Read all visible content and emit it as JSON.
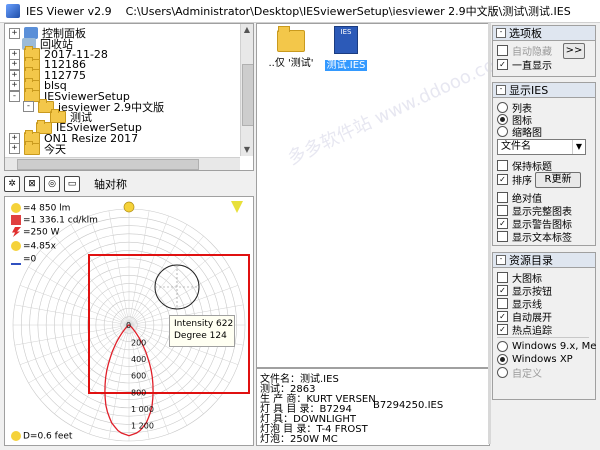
{
  "titlebar": {
    "app": "IES Viewer v2.9",
    "path": "C:\\Users\\Administrator\\Desktop\\IESviewerSetup\\iesviewer 2.9中文版\\测试\\测试.IES"
  },
  "tree": {
    "items": [
      {
        "label": "控制面板",
        "expander": "+",
        "indent": 0,
        "icon": "control-panel-icon"
      },
      {
        "label": "回收站",
        "expander": "",
        "indent": 0,
        "icon": "recycle-bin-icon"
      },
      {
        "label": "2017-11-28",
        "expander": "+",
        "indent": 0,
        "icon": "folder-icon"
      },
      {
        "label": "112186",
        "expander": "+",
        "indent": 0,
        "icon": "folder-icon"
      },
      {
        "label": "112775",
        "expander": "+",
        "indent": 0,
        "icon": "folder-icon"
      },
      {
        "label": "blsq",
        "expander": "+",
        "indent": 0,
        "icon": "folder-icon"
      },
      {
        "label": "IESviewerSetup",
        "expander": "-",
        "indent": 0,
        "icon": "folder-icon"
      },
      {
        "label": "iesviewer 2.9中文版",
        "expander": "-",
        "indent": 1,
        "icon": "folder-icon"
      },
      {
        "label": "测试",
        "expander": "",
        "indent": 2,
        "icon": "folder-icon"
      },
      {
        "label": "IESviewerSetup",
        "expander": "",
        "indent": 1,
        "icon": "folder-icon"
      },
      {
        "label": "ON1 Resize 2017",
        "expander": "+",
        "indent": 0,
        "icon": "folder-icon"
      },
      {
        "label": "今天",
        "expander": "+",
        "indent": 0,
        "icon": "folder-icon"
      }
    ]
  },
  "toolbar": {
    "icons": [
      "polar-view-icon",
      "cartesian-view-icon",
      "isolux-view-icon",
      "render-view-icon"
    ],
    "axis_label": "轴对称"
  },
  "polar": {
    "lumens": "=4 850 lm",
    "peak": "=1 336.1 cd/klm",
    "watts": "=250 W",
    "ratio": "=4.85x",
    "tilt": "=0",
    "distance": "D=0.6 feet",
    "tooltip_intensity": "Intensity 622",
    "tooltip_degree": "Degree 124",
    "ring_labels": [
      "200",
      "400",
      "600",
      "800",
      "1 000",
      "1 200"
    ],
    "ring_values": [
      200,
      400,
      600,
      800,
      1000,
      1200
    ],
    "ring_max": 1400,
    "center_label": "0",
    "curve_color": "#e0202a",
    "highlight_color": "#e01010"
  },
  "files": [
    {
      "label": "..仅 '测试'",
      "type": "folder",
      "selected": false
    },
    {
      "label": "测试.IES",
      "type": "ies",
      "selected": true
    }
  ],
  "info": {
    "lines": [
      "文件名：测试.IES",
      "测试：2863",
      "生 产 商：KURT VERSEN",
      "灯 具 目 录：B7294",
      "灯    具：DOWNLIGHT",
      "灯泡 目 录：T-4 FROST",
      "灯泡：250W MC"
    ],
    "catalog_extra": "B7294250.IES"
  },
  "options_panel": {
    "title": "选项板",
    "auto_hide": "自动隐藏",
    "auto_hide_checked": false,
    "always_show": "一直显示",
    "always_show_checked": true,
    "pin_button": ">>"
  },
  "display_panel": {
    "title": "显示IES",
    "view_list": "列表",
    "view_icon": "图标",
    "view_thumb": "缩略图",
    "selected_view": "图标",
    "sort_value": "文件名",
    "keep_title": "保持标题",
    "keep_title_checked": false,
    "sort": "排序",
    "sort_checked": true,
    "refresh_button": "R更新",
    "absolute": "绝对值",
    "absolute_checked": false,
    "show_full_chart": "显示完整图表",
    "show_full_chart_checked": false,
    "show_warning": "显示警告图标",
    "show_warning_checked": true,
    "show_text_labels": "显示文本标签",
    "show_text_labels_checked": false
  },
  "resource_panel": {
    "title": "资源目录",
    "large_icons": "大图标",
    "large_icons_checked": false,
    "show_buttons": "显示按钮",
    "show_buttons_checked": true,
    "show_lines": "显示线",
    "show_lines_checked": false,
    "auto_expand": "自动展开",
    "auto_expand_checked": true,
    "hot_track": "热点追踪",
    "hot_track_checked": true,
    "style_9x": "Windows 9.x, Me",
    "style_xp": "Windows XP",
    "style_default": "自定义",
    "selected_style": "Windows XP"
  },
  "watermark": "多多软件站 www.ddooo.com"
}
